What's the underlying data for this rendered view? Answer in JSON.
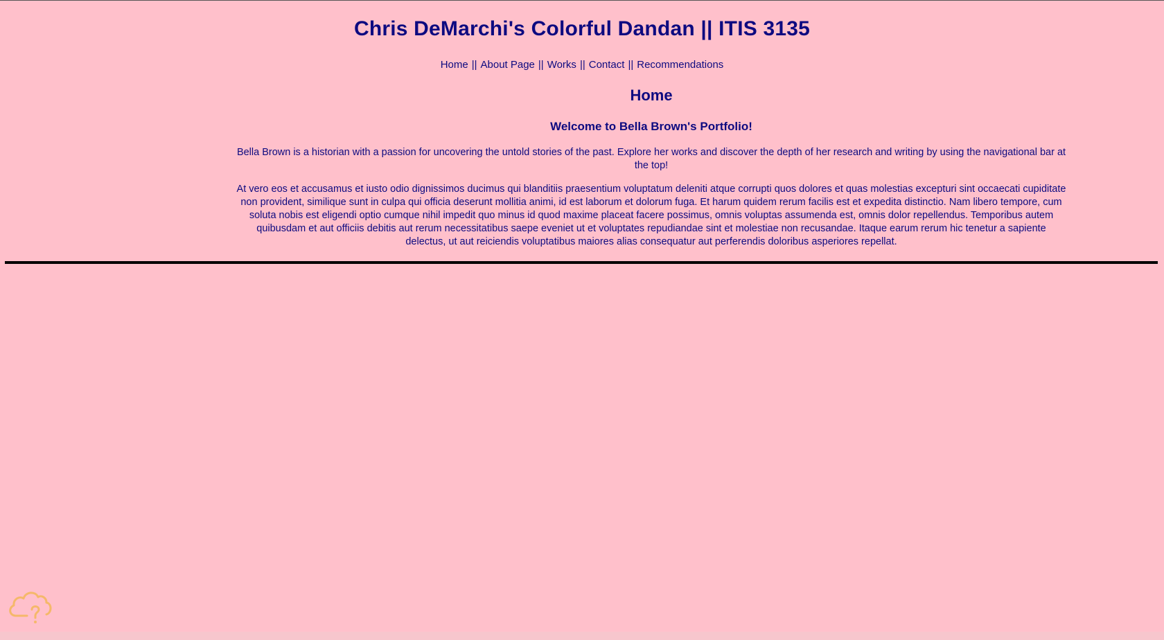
{
  "header": {
    "title": "Chris DeMarchi's Colorful Dandan || ITIS 3135"
  },
  "nav": {
    "items": [
      {
        "label": "Home"
      },
      {
        "label": "About Page"
      },
      {
        "label": "Works"
      },
      {
        "label": "Contact"
      },
      {
        "label": "Recommendations"
      }
    ],
    "separator": "||"
  },
  "main": {
    "heading": "Home",
    "welcome": "Welcome to Bella Brown's Portfolio!",
    "intro": "Bella Brown is a historian with a passion for uncovering the untold stories of the past. Explore her works and discover the depth of her research and writing by using the navigational bar at the top!",
    "lorem": "At vero eos et accusamus et iusto odio dignissimos ducimus qui blanditiis praesentium voluptatum deleniti atque corrupti quos dolores et quas molestias excepturi sint occaecati cupiditate non provident, similique sunt in culpa qui officia deserunt mollitia animi, id est laborum et dolorum fuga. Et harum quidem rerum facilis est et expedita distinctio. Nam libero tempore, cum soluta nobis est eligendi optio cumque nihil impedit quo minus id quod maxime placeat facere possimus, omnis voluptas assumenda est, omnis dolor repellendus. Temporibus autem quibusdam et aut officiis debitis aut rerum necessitatibus saepe eveniet ut et voluptates repudiandae sint et molestiae non recusandae. Itaque earum rerum hic tenetur a sapiente delectus, ut aut reiciendis voluptatibus maiores alias consequatur aut perferendis doloribus asperiores repellat."
  },
  "colors": {
    "background": "#ffc0cb",
    "text": "#0d0a80",
    "divider": "#000000",
    "icon": "#f5b86a"
  },
  "icons": {
    "corner": "cloud-question-icon"
  }
}
